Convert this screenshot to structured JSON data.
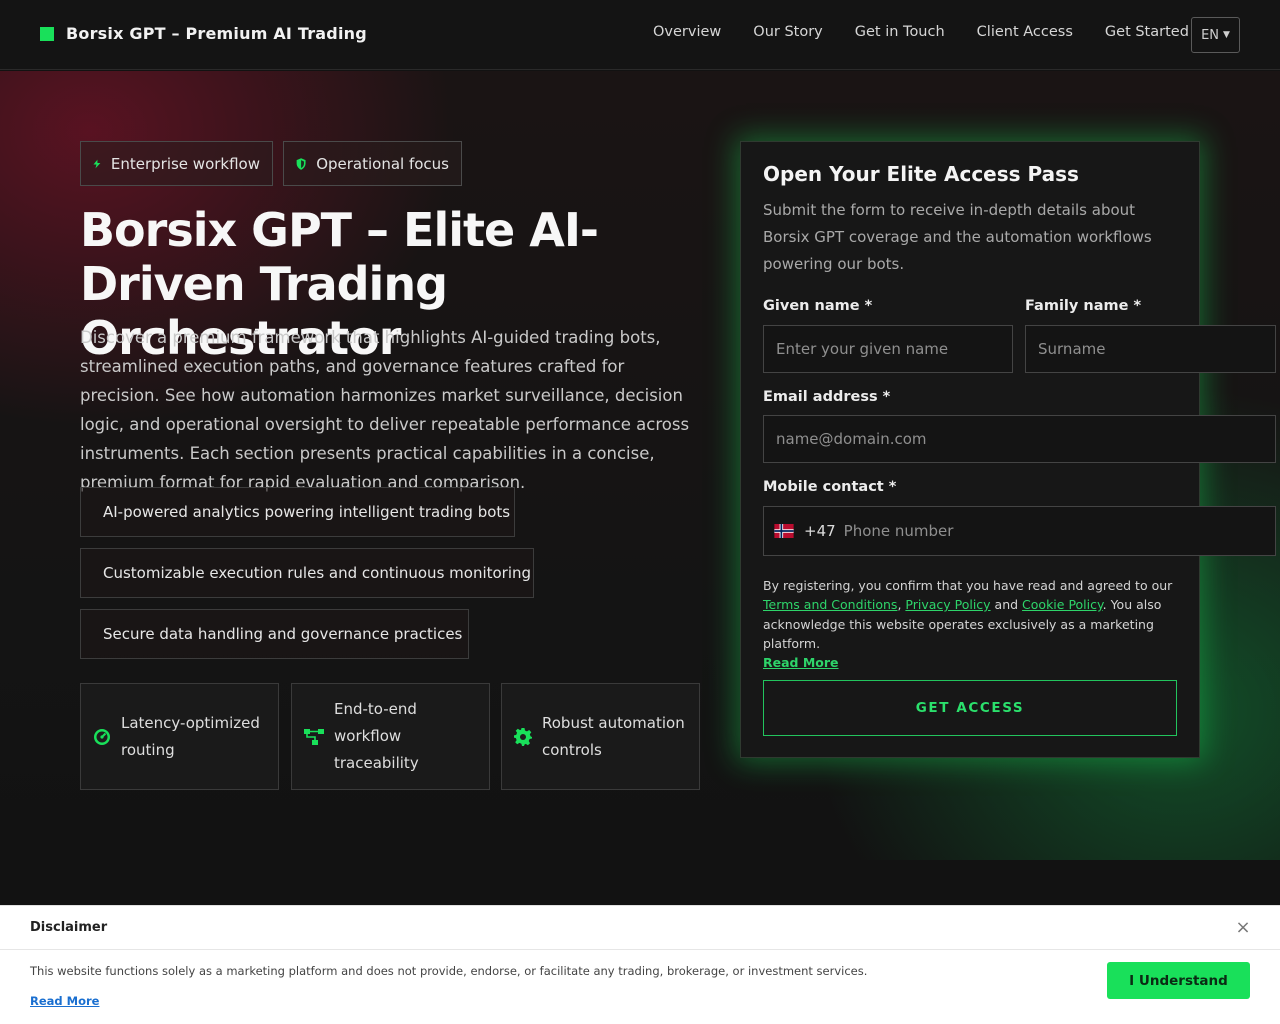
{
  "header": {
    "brand": "Borsix GPT – Premium AI Trading",
    "nav": [
      "Overview",
      "Our Story",
      "Get in Touch",
      "Client Access",
      "Get Started"
    ],
    "language": "EN"
  },
  "hero": {
    "chips": [
      "Enterprise workflow",
      "Operational focus"
    ],
    "title": "Borsix GPT – Elite AI-Driven Trading Orchestrator",
    "description": "Discover a premium framework that highlights AI-guided trading bots, streamlined execution paths, and governance features crafted for precision. See how automa­tion harmonizes market surveillance, decision logic, and operational oversight to deliver repeatable performance across instruments. Each section presents practi­cal capabilities in a concise, premium format for rapid evaluation and comparison.",
    "features": [
      "AI-powered analytics powering intelligent trading bots",
      "Customizable execution rules and continuous monitoring",
      "Secure data handling and governance practices"
    ],
    "cards": [
      "Latency-optimized routing",
      "End-to-end workflow traceability",
      "Robust automation controls"
    ]
  },
  "form": {
    "title": "Open Your Elite Access Pass",
    "subtitle": "Submit the form to receive in-depth details about Borsix GPT coverage and the automation workflows powering our bots.",
    "given_label": "Given name *",
    "given_placeholder": "Enter your given name",
    "family_label": "Family name *",
    "family_placeholder": "Surname",
    "email_label": "Email address *",
    "email_placeholder": "name@domain.com",
    "phone_label": "Mobile contact *",
    "phone_code": "+47",
    "phone_placeholder": "Phone number",
    "legal_prefix": "By registering, you confirm that you have read and agreed to our ",
    "terms": "Terms and Conditions",
    "sep1": ", ",
    "privacy": "Privacy Policy",
    "and": " and ",
    "cookie": "Cookie Policy",
    "legal_suffix": ". You also ac­knowledge this website operates exclusively as a marketing platform.",
    "read_more": "Read More",
    "submit": "GET ACCESS"
  },
  "disclaimer": {
    "title": "Disclaimer",
    "text": "This website functions solely as a marketing platform and does not provide, endorse, or facilitate any trading, brokerage, or investment services.",
    "read_more": "Read More",
    "button": "I Understand",
    "close": "×"
  },
  "colors": {
    "accent": "#19e05a",
    "hero_red": "#6e1226",
    "hero_green": "#126e34"
  },
  "icons": {
    "chips": [
      "bolt-icon",
      "shield-icon"
    ],
    "features": [
      "chip-icon",
      "sliders-icon",
      "lock-icon"
    ],
    "cards": [
      "gauge-icon",
      "workflow-icon",
      "gear-icon"
    ],
    "phone_flag": "norway-flag-icon"
  }
}
